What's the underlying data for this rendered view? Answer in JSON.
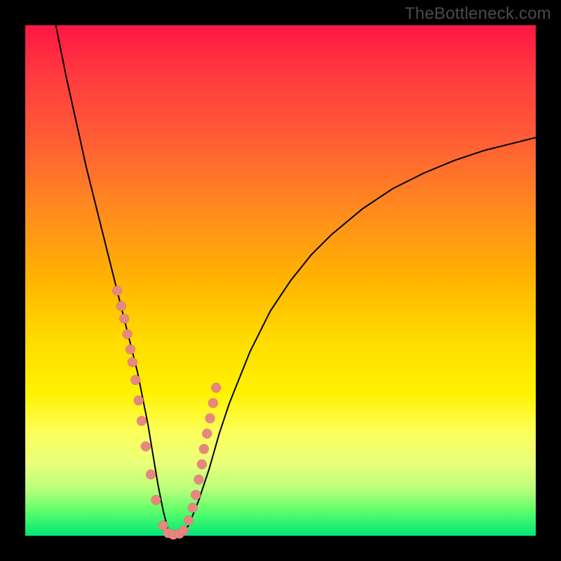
{
  "watermark": "TheBottleneck.com",
  "chart_data": {
    "type": "line",
    "title": "",
    "xlabel": "",
    "ylabel": "",
    "xlim": [
      0,
      100
    ],
    "ylim": [
      0,
      100
    ],
    "grid": false,
    "legend": false,
    "series": [
      {
        "name": "bottleneck-curve",
        "x": [
          6,
          8,
          10,
          12,
          14,
          16,
          18,
          20,
          22,
          23,
          24,
          25,
          26,
          27,
          28,
          29,
          30,
          32,
          34,
          36,
          38,
          40,
          44,
          48,
          52,
          56,
          60,
          66,
          72,
          78,
          84,
          90,
          96,
          100
        ],
        "values": [
          100,
          90,
          81,
          72,
          64,
          56,
          48,
          40,
          32,
          27,
          22,
          16,
          10,
          5,
          1,
          0,
          0,
          2,
          7,
          13,
          20,
          26,
          36,
          44,
          50,
          55,
          59,
          64,
          68,
          71,
          73.5,
          75.5,
          77,
          78
        ]
      }
    ],
    "scatter_points": {
      "name": "highlighted-points",
      "x": [
        18.0,
        18.8,
        19.4,
        20.0,
        20.6,
        21.0,
        21.6,
        22.2,
        22.8,
        23.6,
        24.6,
        25.6,
        27.0,
        28.0,
        29.0,
        30.2,
        31.0,
        32.0,
        32.8,
        33.4,
        34.0,
        34.6,
        35.0,
        35.6,
        36.2,
        36.8,
        37.4
      ],
      "values": [
        48.0,
        45.0,
        42.5,
        39.5,
        36.5,
        34.0,
        30.5,
        26.5,
        22.5,
        17.5,
        12.0,
        7.0,
        2.0,
        0.5,
        0.2,
        0.4,
        1.0,
        3.0,
        5.5,
        8.0,
        11.0,
        14.0,
        17.0,
        20.0,
        23.0,
        26.0,
        29.0
      ]
    },
    "colors": {
      "curve": "#000000",
      "dots": "#e8877f",
      "gradient_top": "#ff1744",
      "gradient_bottom": "#00e676"
    }
  }
}
